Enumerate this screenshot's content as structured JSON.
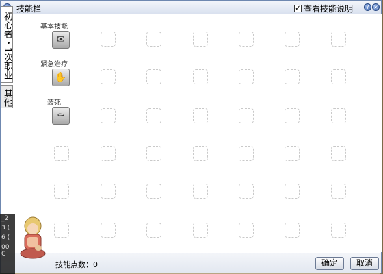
{
  "window": {
    "title": "技能栏",
    "show_description_label": "查看技能说明",
    "show_description_checked": true
  },
  "tabs": [
    {
      "label": "初心者・1次职业"
    },
    {
      "label": "其他"
    }
  ],
  "skills": [
    {
      "name": "基本技能",
      "icon": "basic-skill-icon"
    },
    {
      "name": "紧急治疗",
      "icon": "first-aid-icon"
    },
    {
      "name": "装死",
      "icon": "play-dead-icon"
    }
  ],
  "grid": {
    "rows": 6,
    "cols": 7
  },
  "footer": {
    "skill_points_label": "技能点数：0",
    "confirm_label": "确定",
    "cancel_label": "取消"
  },
  "background_strip": {
    "line1": "_2",
    "line2": "3 (",
    "line3": "6 (",
    "line4": "00 C"
  }
}
